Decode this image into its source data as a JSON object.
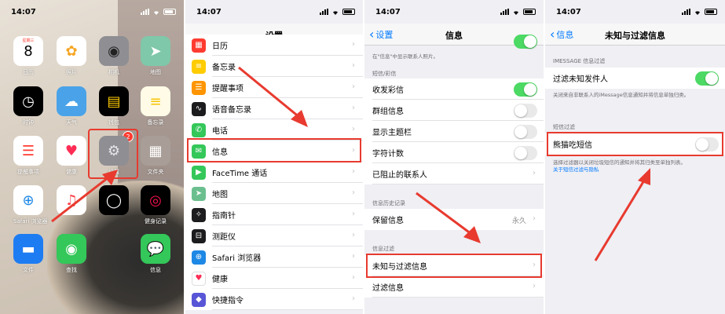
{
  "panel1": {
    "time": "14:07",
    "apps": [
      {
        "label": "日历",
        "glyph": "8",
        "bg": "#ffffff",
        "color": "#000000"
      },
      {
        "label": "照片",
        "glyph": "✿",
        "bg": "#ffffff",
        "color": "#f5a623"
      },
      {
        "label": "相机",
        "glyph": "◉",
        "bg": "#8e8e93",
        "color": "#222222"
      },
      {
        "label": "地图",
        "glyph": "➤",
        "bg": "#7fc8a9",
        "color": "#ffffff"
      },
      {
        "label": "时钟",
        "glyph": "◷",
        "bg": "#000000",
        "color": "#ffffff"
      },
      {
        "label": "天气",
        "glyph": "☁",
        "bg": "#4aa3e8",
        "color": "#ffffff"
      },
      {
        "label": "钱包",
        "glyph": "▤",
        "bg": "#000000",
        "color": "#ffcc00"
      },
      {
        "label": "备忘录",
        "glyph": "≡",
        "bg": "#fffbe6",
        "color": "#f5c400"
      },
      {
        "label": "提醒事项",
        "glyph": "☰",
        "bg": "#ffffff",
        "color": "#ff3b30"
      },
      {
        "label": "健康",
        "glyph": "♥",
        "bg": "#ffffff",
        "color": "#ff2d55"
      },
      {
        "label": "设置",
        "glyph": "⚙",
        "bg": "#8e8e93",
        "color": "#e5e5ea"
      },
      {
        "label": "文件夹",
        "glyph": "▦",
        "bg": "#a89e97",
        "color": "#ffffff"
      },
      {
        "label": "Safari 浏览器",
        "glyph": "⊕",
        "bg": "#ffffff",
        "color": "#1e88e5"
      },
      {
        "label": "",
        "glyph": "♫",
        "bg": "#ffffff",
        "color": "#fc3c44"
      },
      {
        "label": "",
        "glyph": "◯",
        "bg": "#000000",
        "color": "#ffffff"
      },
      {
        "label": "健身记录",
        "glyph": "◎",
        "bg": "#000000",
        "color": "#fa114f"
      },
      {
        "label": "文件",
        "glyph": "▬",
        "bg": "#1e7cf2",
        "color": "#ffffff"
      },
      {
        "label": "查找",
        "glyph": "◉",
        "bg": "#34c759",
        "color": "#ffffff"
      },
      {
        "label": "",
        "glyph": "",
        "bg": "transparent",
        "color": "#ffffff"
      },
      {
        "label": "信息",
        "glyph": "💬",
        "bg": "#34c759",
        "color": "#ffffff"
      }
    ],
    "settings_badge": "2",
    "calendar_day": "星期三"
  },
  "panel2": {
    "time": "14:07",
    "title": "设置",
    "rows": [
      {
        "label": "日历",
        "icon_bg": "#ff3b30",
        "glyph": "▦"
      },
      {
        "label": "备忘录",
        "icon_bg": "#ffcc00",
        "glyph": "≡"
      },
      {
        "label": "提醒事项",
        "icon_bg": "#ff9500",
        "glyph": "☰"
      },
      {
        "label": "语音备忘录",
        "icon_bg": "#1c1c1e",
        "glyph": "∿"
      },
      {
        "label": "电话",
        "icon_bg": "#34c759",
        "glyph": "✆"
      },
      {
        "label": "信息",
        "icon_bg": "#34c759",
        "glyph": "✉"
      },
      {
        "label": "FaceTime 通话",
        "icon_bg": "#34c759",
        "glyph": "▶"
      },
      {
        "label": "地图",
        "icon_bg": "#6bbf8f",
        "glyph": "➤"
      },
      {
        "label": "指南针",
        "icon_bg": "#1c1c1e",
        "glyph": "✧"
      },
      {
        "label": "测距仪",
        "icon_bg": "#1c1c1e",
        "glyph": "⊟"
      },
      {
        "label": "Safari 浏览器",
        "icon_bg": "#1e88e5",
        "glyph": "⊕"
      },
      {
        "label": "健康",
        "icon_bg": "#ffffff",
        "glyph": "♥"
      },
      {
        "label": "快捷指令",
        "icon_bg": "#5856d6",
        "glyph": "◆"
      }
    ]
  },
  "panel3": {
    "time": "14:07",
    "back": "设置",
    "title": "信息",
    "top_note": "在\"信息\"中显示联系人照片。",
    "sec_sms": "短信/彩信",
    "rows_sms": [
      {
        "label": "收发彩信",
        "toggle": true
      },
      {
        "label": "群组信息",
        "toggle": false
      },
      {
        "label": "显示主题栏",
        "toggle": false
      },
      {
        "label": "字符计数",
        "toggle": false
      },
      {
        "label": "已阻止的联系人",
        "chevron": true
      }
    ],
    "sec_history": "信息历史记录",
    "keep_label": "保留信息",
    "keep_value": "永久",
    "sec_filter": "信息过滤",
    "filter_rows": [
      {
        "label": "未知与过滤信息"
      },
      {
        "label": "过滤信息"
      }
    ]
  },
  "panel4": {
    "time": "14:07",
    "back": "信息",
    "title": "未知与过滤信息",
    "sec_imessage": "IMESSAGE 信息过滤",
    "filter_unknown": "过滤未知发件人",
    "imessage_note": "关闭来自非联系人的iMessage信息通知并将信息单独归类。",
    "sec_sms": "短信过滤",
    "panda": "熊猫吃短信",
    "sms_note": "选择过滤器以关闭垃圾短信的通知并将其归类至单独列表。",
    "sms_link": "关于短信过滤与隐私"
  }
}
